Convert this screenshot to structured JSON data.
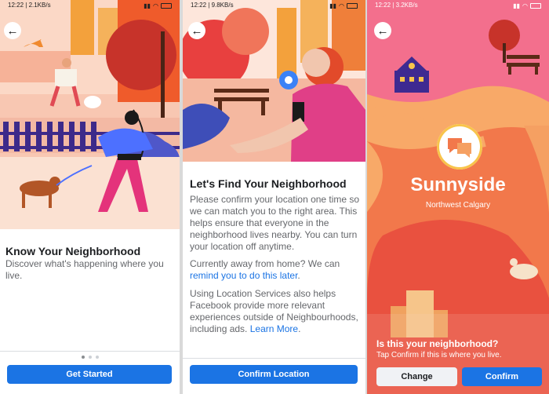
{
  "screens": [
    {
      "status": {
        "time": "12:22",
        "speed": "2.1KB/s"
      },
      "title": "Know Your Neighborhood",
      "body": "Discover what's happening where you live.",
      "cta": "Get Started",
      "dots": 3
    },
    {
      "status": {
        "time": "12:22",
        "speed": "9.8KB/s"
      },
      "title": "Let's Find Your Neighborhood",
      "paragraph1": "Please confirm your location one time so we can match you to the right area. This helps ensure that everyone in the neighborhood lives nearby. You can turn your location off anytime.",
      "paragraph2_prefix": "Currently away from home? We can",
      "paragraph2_link": "remind you to do this later",
      "paragraph3_prefix": "Using Location Services also helps Facebook provide more relevant experiences outside of Neighbourhoods, including ads.",
      "paragraph3_link": "Learn More",
      "cta": "Confirm Location"
    },
    {
      "status": {
        "time": "12:22",
        "speed": "3.2KB/s"
      },
      "neighborhood": "Sunnyside",
      "region": "Northwest Calgary",
      "question": "Is this your neighborhood?",
      "hint": "Tap Confirm if this is where you live.",
      "change": "Change",
      "confirm": "Confirm"
    }
  ],
  "icons": {
    "back": "back-arrow-icon",
    "battery": "battery-icon",
    "wifi": "wifi-icon",
    "signal": "signal-icon"
  },
  "colors": {
    "accent": "#1b74e4",
    "orange": "#f39a3d",
    "pink": "#f25f87",
    "coral": "#f0755a"
  }
}
